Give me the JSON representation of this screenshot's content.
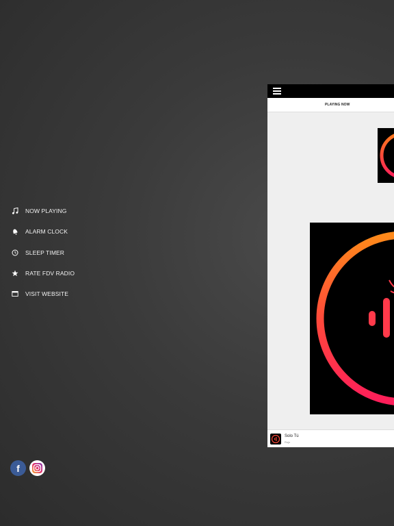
{
  "menu": {
    "items": [
      {
        "label": "NOW PLAYING",
        "icon": "music-note-icon"
      },
      {
        "label": "ALARM CLOCK",
        "icon": "bell-icon"
      },
      {
        "label": "SLEEP TIMER",
        "icon": "clock-icon"
      },
      {
        "label": "RATE FDV RADIO",
        "icon": "star-icon"
      },
      {
        "label": "VISIT WEBSITE",
        "icon": "browser-window-icon"
      }
    ]
  },
  "social": {
    "facebook_glyph": "f",
    "icons": [
      "facebook-icon",
      "instagram-icon"
    ]
  },
  "panel": {
    "tab_label": "PLAYING NOW",
    "now_playing": {
      "title": "Solo Tú",
      "artist": "Rojo"
    }
  },
  "colors": {
    "background": "#3a3a3a",
    "ring_start": "#ff7a1a",
    "ring_end": "#ff1e5a",
    "facebook": "#3b5b96"
  }
}
